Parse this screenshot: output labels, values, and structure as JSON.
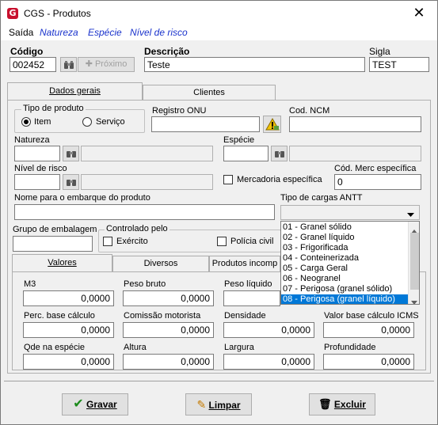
{
  "window": {
    "title": "CGS - Produtos",
    "close": "✕"
  },
  "menu": {
    "items": [
      "Saída",
      "Natureza",
      "Espécie",
      "Nível de risco"
    ]
  },
  "header": {
    "codigo_label": "Código",
    "codigo_value": "002452",
    "proximo_label": "Próximo",
    "descricao_label": "Descrição",
    "descricao_value": "Teste",
    "sigla_label": "Sigla",
    "sigla_value": "TEST"
  },
  "tabs_top": [
    "Dados gerais",
    "Clientes"
  ],
  "dados": {
    "tipo_produto_title": "Tipo de produto",
    "item_label": "Item",
    "servico_label": "Serviço",
    "registro_onu_label": "Registro ONU",
    "cod_ncm_label": "Cod. NCM",
    "natureza_label": "Natureza",
    "especie_label": "Espécie",
    "nivel_risco_label": "Nível de risco",
    "mercadoria_label": "Mercadoria específica",
    "cod_merc_label": "Cód. Merc específica",
    "cod_merc_value": "0",
    "nome_embarque_label": "Nome para o embarque do produto",
    "tipo_cargas_label": "Tipo de cargas ANTT",
    "grupo_embalagem_label": "Grupo de embalagem",
    "controlado_title": "Controlado pelo",
    "exercito_label": "Exército",
    "policia_label": "Polícia civil"
  },
  "cargas_options": [
    "01 - Granel sólido",
    "02 - Granel líquido",
    "03 - Frigorificada",
    "04 - Conteinerizada",
    "05 - Carga Geral",
    "06 - Neogranel",
    "07 - Perigosa (granel sólido)",
    "08 - Perigosa (granel líquido)"
  ],
  "tabs_inner": [
    "Valores",
    "Diversos",
    "Produtos incomp"
  ],
  "valores": {
    "m3_label": "M3",
    "m3_value": "0,0000",
    "peso_bruto_label": "Peso bruto",
    "peso_bruto_value": "0,0000",
    "peso_liquido_label": "Peso líquido",
    "perc_base_label": "Perc. base cálculo",
    "perc_base_value": "0,0000",
    "comissao_label": "Comissão motorista",
    "comissao_value": "0,0000",
    "densidade_label": "Densidade",
    "densidade_value": "0,0000",
    "valor_base_icms_label": "Valor base cálculo ICMS",
    "valor_base_icms_value": "0,0000",
    "qde_especie_label": "Qde na espécie",
    "qde_especie_value": "0,0000",
    "altura_label": "Altura",
    "altura_value": "0,0000",
    "largura_label": "Largura",
    "largura_value": "0,0000",
    "profundidade_label": "Profundidade",
    "profundidade_value": "0,0000"
  },
  "buttons": {
    "gravar": "Gravar",
    "limpar": "Limpar",
    "excluir": "Excluir"
  }
}
